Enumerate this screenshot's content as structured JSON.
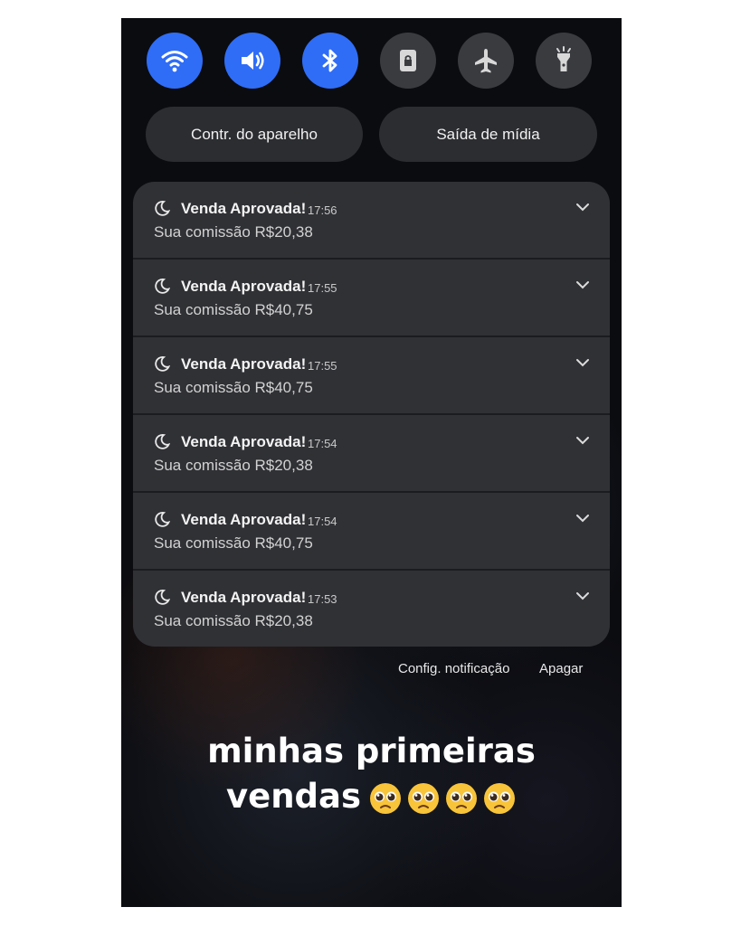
{
  "quick_settings": [
    {
      "name": "wifi-icon",
      "state": "on"
    },
    {
      "name": "sound-icon",
      "state": "on"
    },
    {
      "name": "bluetooth-icon",
      "state": "on"
    },
    {
      "name": "portrait-lock-icon",
      "state": "off"
    },
    {
      "name": "airplane-icon",
      "state": "off"
    },
    {
      "name": "flashlight-icon",
      "state": "off"
    }
  ],
  "buttons": {
    "device_control": "Contr. do aparelho",
    "media_output": "Saída de mídia"
  },
  "notifications": [
    {
      "title": "Venda Aprovada!",
      "time": "17:56",
      "body": "Sua comissão R$20,38"
    },
    {
      "title": "Venda Aprovada!",
      "time": "17:55",
      "body": "Sua comissão R$40,75"
    },
    {
      "title": "Venda Aprovada!",
      "time": "17:55",
      "body": "Sua comissão R$40,75"
    },
    {
      "title": "Venda Aprovada!",
      "time": "17:54",
      "body": "Sua comissão R$20,38"
    },
    {
      "title": "Venda Aprovada!",
      "time": "17:54",
      "body": "Sua comissão R$40,75"
    },
    {
      "title": "Venda Aprovada!",
      "time": "17:53",
      "body": "Sua comissão R$20,38"
    }
  ],
  "footer": {
    "settings_link": "Config. notificação",
    "clear_link": "Apagar"
  },
  "caption": {
    "line1": "minhas primeiras",
    "line2": "vendas"
  },
  "colors": {
    "accent_on": "#2f6df6",
    "tile_off": "#3a3b3f",
    "notification_bg": "#303135"
  }
}
